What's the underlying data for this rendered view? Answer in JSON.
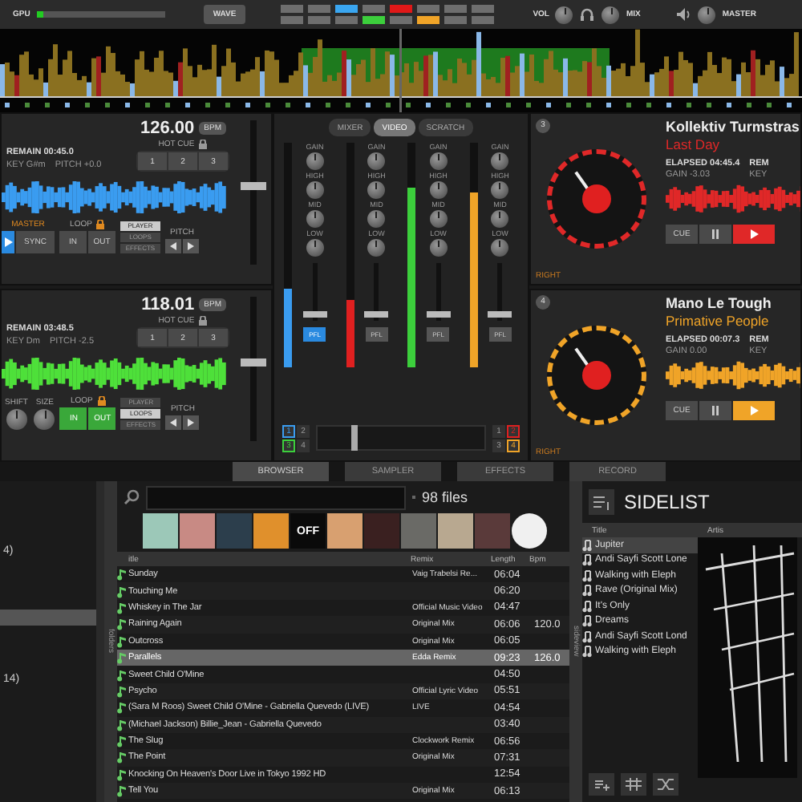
{
  "top_bar": {
    "gpu_label": "GPU",
    "wave_button": "WAVE",
    "pads": [
      {
        "color": "#6e6e6e"
      },
      {
        "color": "#6e6e6e"
      },
      {
        "color": "#3aa6f0"
      },
      {
        "color": "#6e6e6e"
      },
      {
        "color": "#e01818"
      },
      {
        "color": "#6e6e6e"
      },
      {
        "color": "#6e6e6e"
      },
      {
        "color": "#6e6e6e"
      },
      {
        "color": "#6e6e6e"
      },
      {
        "color": "#6e6e6e"
      },
      {
        "color": "#6e6e6e"
      },
      {
        "color": "#3ccf3c"
      },
      {
        "color": "#6e6e6e"
      },
      {
        "color": "#f0a428"
      },
      {
        "color": "#6e6e6e"
      },
      {
        "color": "#6e6e6e"
      }
    ],
    "vol_label": "VOL",
    "mix_label": "MIX",
    "master_label": "MASTER"
  },
  "left_decks": [
    {
      "kind": "sync",
      "bpm": "126.00",
      "bpm_unit": "BPM",
      "time": "REMAIN 00:45.0",
      "key": "KEY G#m",
      "pitch": "PITCH +0.0",
      "hot_cue_label": "HOT CUE",
      "hot_cues": [
        "1",
        "2",
        "3"
      ],
      "color": "#3a9cf0",
      "master_label": "MASTER",
      "sync_label": "SYNC",
      "loop_label": "LOOP",
      "loop_in": "IN",
      "loop_out": "OUT",
      "loop_on": false,
      "panel_buttons": [
        {
          "label": "PLAYER",
          "selected": true
        },
        {
          "label": "LOOPS",
          "selected": false
        },
        {
          "label": "EFFECTS",
          "selected": false
        }
      ],
      "pitch_label": "PITCH",
      "level": 0.55
    },
    {
      "kind": "knobs",
      "bpm": "118.01",
      "bpm_unit": "BPM",
      "time": "REMAIN 03:48.5",
      "key": "KEY Dm",
      "pitch": "PITCH -2.5",
      "hot_cue_label": "HOT CUE",
      "hot_cues": [
        "1",
        "2",
        "3"
      ],
      "color": "#4ee03a",
      "shift_label": "SHIFT",
      "size_label": "SIZE",
      "loop_label": "LOOP",
      "loop_in": "IN",
      "loop_out": "OUT",
      "loop_on": true,
      "panel_buttons": [
        {
          "label": "PLAYER",
          "selected": false
        },
        {
          "label": "LOOPS",
          "selected": true
        },
        {
          "label": "EFFECTS",
          "selected": false
        }
      ],
      "pitch_label": "PITCH",
      "level": 0.55
    }
  ],
  "mixer": {
    "tabs": [
      {
        "label": "MIXER",
        "selected": false
      },
      {
        "label": "VIDEO",
        "selected": true
      },
      {
        "label": "SCRATCH",
        "selected": false
      }
    ],
    "channels": [
      {
        "knobs": [
          "GAIN",
          "HIGH",
          "MID",
          "LOW"
        ],
        "pfl": "PFL",
        "pfl_on": true,
        "color": "#3a9cf0",
        "level": 0.35
      },
      {
        "knobs": [
          "GAIN",
          "HIGH",
          "MID",
          "LOW"
        ],
        "pfl": "PFL",
        "pfl_on": false,
        "color": "#e02020",
        "level": 0.3
      },
      {
        "knobs": [
          "GAIN",
          "HIGH",
          "MID",
          "LOW"
        ],
        "pfl": "PFL",
        "pfl_on": false,
        "color": "#3ccf3c",
        "level": 0.8
      },
      {
        "knobs": [
          "GAIN",
          "HIGH",
          "MID",
          "LOW"
        ],
        "pfl": "PFL",
        "pfl_on": false,
        "color": "#f0a428",
        "level": 0.78
      }
    ],
    "left_selectors": [
      {
        "label": "1",
        "color": "#3a9cf0"
      },
      {
        "label": "3",
        "color": "#3ccf3c"
      }
    ],
    "left_selectors_b": [
      {
        "label": "2",
        "selected": false
      },
      {
        "label": "4",
        "selected": false
      }
    ],
    "right_selectors": [
      {
        "label": "1",
        "selected": false
      },
      {
        "label": "3",
        "selected": false
      }
    ],
    "right_selectors_b": [
      {
        "label": "2",
        "color": "#e02020"
      },
      {
        "label": "4",
        "color": "#f0a428"
      }
    ],
    "crossfader": {
      "level": 0.2
    }
  },
  "right_decks": [
    {
      "number": "3",
      "artist": "Kollektiv Turmstras",
      "title": "Last Day",
      "color": "#e02828",
      "elapsed": "ELAPSED 04:45.4",
      "gain": "GAIN -3.03",
      "rem": "REM",
      "key": "KEY",
      "cue": "CUE",
      "side": "RIGHT"
    },
    {
      "number": "4",
      "artist": "Mano Le Tough",
      "title": "Primative People",
      "color": "#f0a428",
      "elapsed": "ELAPSED 00:07.3",
      "gain": "GAIN 0.00",
      "rem": "REM",
      "key": "KEY",
      "cue": "CUE",
      "side": "RIGHT"
    }
  ],
  "nav_tabs": [
    {
      "label": "BROWSER",
      "selected": true
    },
    {
      "label": "SAMPLER",
      "selected": false
    },
    {
      "label": "EFFECTS",
      "selected": false
    },
    {
      "label": "RECORD",
      "selected": false
    }
  ],
  "folders": {
    "items": [
      {
        "label": "4)",
        "selected": false
      },
      {
        "selected": true
      },
      {
        "label": "14)",
        "selected": false
      }
    ],
    "tab": "folders"
  },
  "browser": {
    "file_count": "98 files",
    "covers": [
      {
        "color": "#9cc8b8"
      },
      {
        "color": "#c88a84"
      },
      {
        "color": "#2c3e4c"
      },
      {
        "color": "#e0902c"
      },
      {
        "color": "#0a0a0a",
        "text": "OFF"
      },
      {
        "color": "#d8a070"
      },
      {
        "color": "#3a2020"
      },
      {
        "color": "#6a6a66"
      },
      {
        "color": "#b8a890"
      },
      {
        "color": "#5a3a3a"
      },
      {
        "color": "#f0f0f0"
      }
    ],
    "columns": [
      "itle",
      "Remix",
      "Length",
      "Bpm"
    ],
    "rows": [
      {
        "title": "Sunday",
        "remix": "Vaig Trabelsi Re...",
        "length": "06:04",
        "selected": false
      },
      {
        "title": "Touching Me",
        "length": "06:20",
        "selected": false
      },
      {
        "title": "Whiskey in The Jar",
        "remix": "Official Music Video",
        "length": "04:47",
        "selected": false
      },
      {
        "title": "Raining Again",
        "remix": "Original Mix",
        "length": "06:06",
        "bpm": "120.0",
        "selected": false
      },
      {
        "title": "Outcross",
        "remix": "Original Mix",
        "length": "06:05",
        "selected": false
      },
      {
        "title": "Parallels",
        "remix": "Edda Remix",
        "length": "09:23",
        "bpm": "126.0",
        "selected": true
      },
      {
        "title": "Sweet Child O'Mine",
        "length": "04:50",
        "selected": false
      },
      {
        "title": "Psycho",
        "remix": "Official Lyric Video",
        "length": "05:51",
        "selected": false
      },
      {
        "title": "(Sara M Roos) Sweet Child O'Mine - Gabriella Quevedo (LIVE)",
        "remix": "LIVE",
        "length": "04:54",
        "selected": false
      },
      {
        "title": "(Michael Jackson) Billie_Jean - Gabriella Quevedo",
        "length": "03:40",
        "selected": false
      },
      {
        "title": "The Slug",
        "remix": "Clockwork Remix",
        "length": "06:56",
        "selected": false
      },
      {
        "title": "The Point",
        "remix": "Original Mix",
        "length": "07:31",
        "selected": false
      },
      {
        "title": "Knocking On Heaven's Door Live in Tokyo 1992 HD",
        "length": "12:54",
        "selected": false
      },
      {
        "title": "Tell You",
        "remix": "Original Mix",
        "length": "06:13",
        "selected": false
      }
    ],
    "side_tab": "sideview"
  },
  "sidelist": {
    "title": "SIDELIST",
    "columns": [
      "Title",
      "Artis"
    ],
    "rows": [
      {
        "title": "Jupiter",
        "selected": true
      },
      {
        "title": "Andi Sayfi Scott Lone",
        "selected": false
      },
      {
        "title": "Walking with Eleph",
        "selected": false
      },
      {
        "title": "Rave (Original Mix)",
        "selected": false
      },
      {
        "title": "It's Only",
        "selected": false
      },
      {
        "title": "Dreams",
        "selected": false
      },
      {
        "title": "Andi Sayfi Scott Lond",
        "selected": false
      },
      {
        "title": "Walking with Eleph",
        "selected": false
      }
    ]
  }
}
